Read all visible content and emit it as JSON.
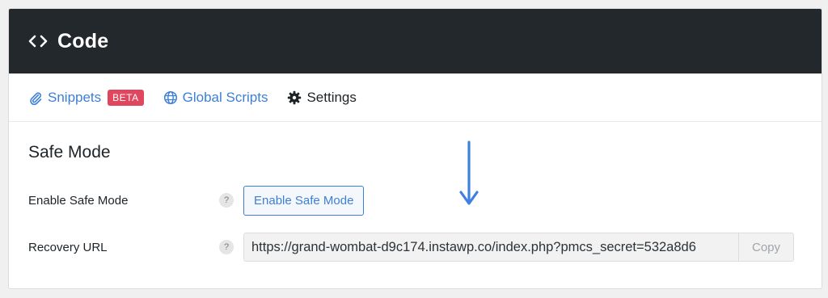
{
  "header": {
    "title": "Code",
    "icon": "code-brackets-icon"
  },
  "tabs": [
    {
      "label": "Snippets",
      "icon": "paperclip-icon",
      "badge": "BETA"
    },
    {
      "label": "Global Scripts",
      "icon": "globe-icon"
    },
    {
      "label": "Settings",
      "icon": "gear-icon"
    }
  ],
  "safe_mode": {
    "title": "Safe Mode",
    "enable_label": "Enable Safe Mode",
    "enable_help": "?",
    "enable_button": "Enable Safe Mode",
    "recovery_label": "Recovery URL",
    "recovery_help": "?",
    "recovery_url": "https://grand-wombat-d9c174.instawp.co/index.php?pmcs_secret=532a8d6",
    "copy_button": "Copy"
  },
  "colors": {
    "header_bg": "#23282d",
    "accent": "#3c7fd6",
    "badge": "#e0465e",
    "annotation_arrow": "#3f80e0"
  }
}
